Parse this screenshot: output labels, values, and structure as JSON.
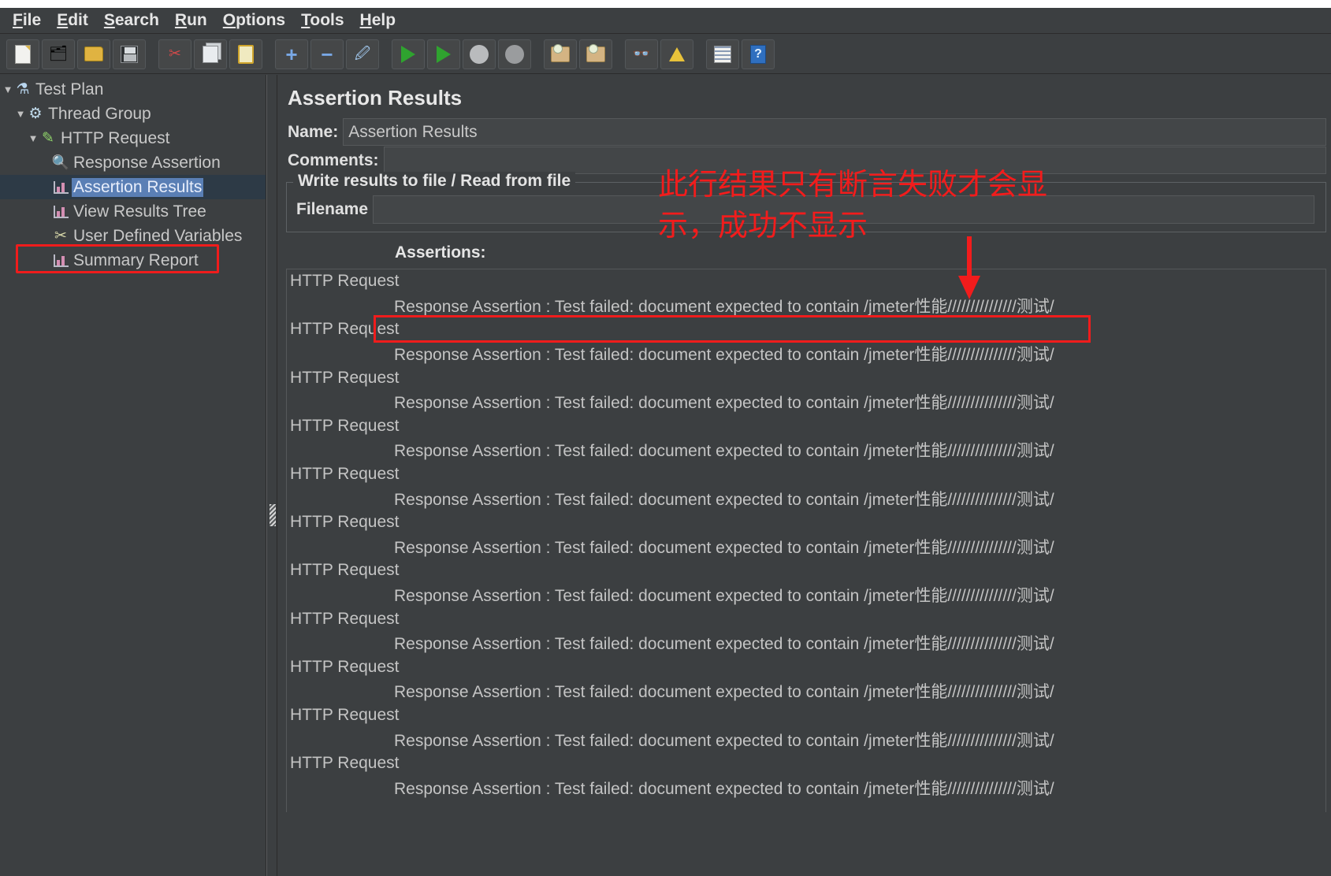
{
  "window": {
    "menubar": [
      {
        "name": "file",
        "label": "File",
        "mnemonic": "F"
      },
      {
        "name": "edit",
        "label": "Edit",
        "mnemonic": "E"
      },
      {
        "name": "search",
        "label": "Search",
        "mnemonic": "S"
      },
      {
        "name": "run",
        "label": "Run",
        "mnemonic": "R"
      },
      {
        "name": "options",
        "label": "Options",
        "mnemonic": "O"
      },
      {
        "name": "tools",
        "label": "Tools",
        "mnemonic": "T"
      },
      {
        "name": "help",
        "label": "Help",
        "mnemonic": "H"
      }
    ]
  },
  "toolbar": {
    "buttons": [
      {
        "name": "new-icon",
        "title": "New"
      },
      {
        "name": "templates-icon",
        "title": "Templates"
      },
      {
        "name": "open-icon",
        "title": "Open"
      },
      {
        "name": "save-icon",
        "title": "Save Test Plan"
      },
      {
        "name": "cut-icon",
        "title": "Cut"
      },
      {
        "name": "copy-icon",
        "title": "Copy"
      },
      {
        "name": "paste-icon",
        "title": "Paste"
      },
      {
        "name": "expand-all-icon",
        "title": "Expand All"
      },
      {
        "name": "collapse-all-icon",
        "title": "Collapse All"
      },
      {
        "name": "toggle-icon",
        "title": "Toggle"
      },
      {
        "name": "start-icon",
        "title": "Start"
      },
      {
        "name": "start-no-pauses-icon",
        "title": "Start no pauses"
      },
      {
        "name": "stop-icon",
        "title": "Stop"
      },
      {
        "name": "shutdown-icon",
        "title": "Shutdown"
      },
      {
        "name": "clear-icon",
        "title": "Clear"
      },
      {
        "name": "clear-all-icon",
        "title": "Clear All"
      },
      {
        "name": "search-icon",
        "title": "Search"
      },
      {
        "name": "search-reset-icon",
        "title": "Reset Search"
      },
      {
        "name": "function-helper-icon",
        "title": "Function Helper Dialog"
      },
      {
        "name": "help-icon",
        "title": "Help"
      }
    ]
  },
  "tree": {
    "items": [
      {
        "name": "test-plan",
        "label": "Test Plan",
        "icon": "beaker-icon",
        "depth": 0,
        "twisty": "▼",
        "selected": false
      },
      {
        "name": "thread-group",
        "label": "Thread Group",
        "icon": "gear-icon",
        "depth": 1,
        "twisty": "▼",
        "selected": false
      },
      {
        "name": "http-request",
        "label": "HTTP Request",
        "icon": "pencil-icon",
        "depth": 2,
        "twisty": "▼",
        "selected": false
      },
      {
        "name": "response-assertion",
        "label": "Response Assertion",
        "icon": "magnifier-icon",
        "depth": 3,
        "twisty": "",
        "selected": false
      },
      {
        "name": "assertion-results",
        "label": "Assertion Results",
        "icon": "chart-icon",
        "depth": 3,
        "twisty": "",
        "selected": true
      },
      {
        "name": "view-results-tree",
        "label": "View Results Tree",
        "icon": "chart-icon",
        "depth": 3,
        "twisty": "",
        "selected": false
      },
      {
        "name": "user-defined-variables",
        "label": "User Defined Variables",
        "icon": "tools-icon",
        "depth": 3,
        "twisty": "",
        "selected": false
      },
      {
        "name": "summary-report",
        "label": "Summary Report",
        "icon": "chart-icon",
        "depth": 3,
        "twisty": "",
        "selected": false
      }
    ]
  },
  "panel": {
    "title": "Assertion Results",
    "name_label": "Name:",
    "name_value": "Assertion Results",
    "comments_label": "Comments:",
    "comments_value": "",
    "group_legend": "Write results to file / Read from file",
    "filename_label": "Filename",
    "filename_value": "",
    "assertions_label": "Assertions:"
  },
  "results": {
    "request_label": "HTTP Request",
    "assertion_text": "Response Assertion : Test failed: document expected to contain /jmeter性能///////////////测试/",
    "rows": [
      {
        "request": "HTTP Request",
        "assertion": "Response Assertion : Test failed: document expected to contain /jmeter性能///////////////测试/",
        "highlighted": true
      },
      {
        "request": "HTTP Request",
        "assertion": "Response Assertion : Test failed: document expected to contain /jmeter性能///////////////测试/",
        "highlighted": false
      },
      {
        "request": "HTTP Request",
        "assertion": "Response Assertion : Test failed: document expected to contain /jmeter性能///////////////测试/",
        "highlighted": false
      },
      {
        "request": "HTTP Request",
        "assertion": "Response Assertion : Test failed: document expected to contain /jmeter性能///////////////测试/",
        "highlighted": false
      },
      {
        "request": "HTTP Request",
        "assertion": "Response Assertion : Test failed: document expected to contain /jmeter性能///////////////测试/",
        "highlighted": false
      },
      {
        "request": "HTTP Request",
        "assertion": "Response Assertion : Test failed: document expected to contain /jmeter性能///////////////测试/",
        "highlighted": false
      },
      {
        "request": "HTTP Request",
        "assertion": "Response Assertion : Test failed: document expected to contain /jmeter性能///////////////测试/",
        "highlighted": false
      },
      {
        "request": "HTTP Request",
        "assertion": "Response Assertion : Test failed: document expected to contain /jmeter性能///////////////测试/",
        "highlighted": false
      },
      {
        "request": "HTTP Request",
        "assertion": "Response Assertion : Test failed: document expected to contain /jmeter性能///////////////测试/",
        "highlighted": false
      },
      {
        "request": "HTTP Request",
        "assertion": "Response Assertion : Test failed: document expected to contain /jmeter性能///////////////测试/",
        "highlighted": false
      },
      {
        "request": "HTTP Request",
        "assertion": "Response Assertion : Test failed: document expected to contain /jmeter性能///////////////测试/",
        "highlighted": false
      }
    ]
  },
  "annotation": {
    "text": "此行结果只有断言失败才会显\n示，成功不显示",
    "color": "#f21c1c",
    "arrow": "down-arrow-icon"
  },
  "colors": {
    "background": "#3c3f41",
    "text": "#c8c8c8",
    "selection": "#5a7fb5",
    "highlight_red": "#f01c1c"
  }
}
